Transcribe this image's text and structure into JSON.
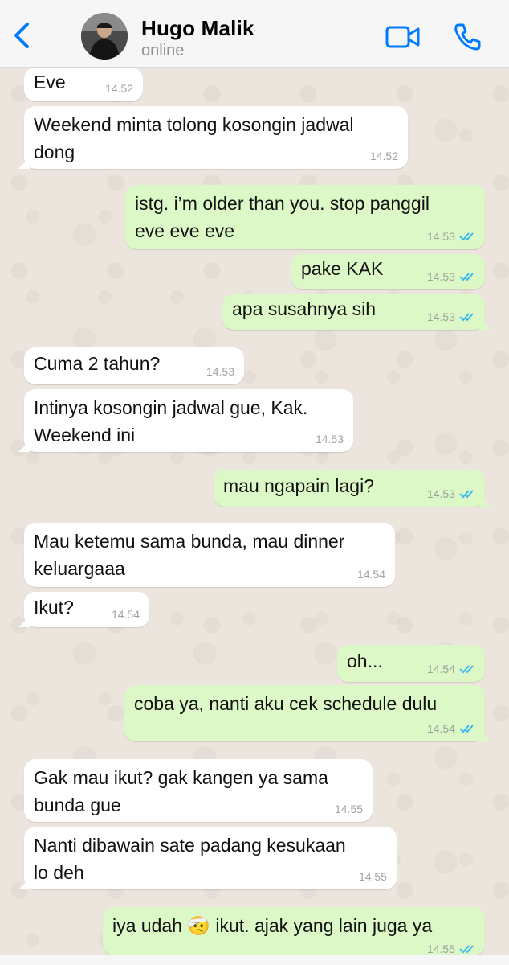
{
  "header": {
    "contact_name": "Hugo Malik",
    "status": "online"
  },
  "icons": {
    "back": "chevron-left-icon",
    "video": "video-call-icon",
    "call": "phone-icon",
    "read_receipt": "double-check-icon"
  },
  "colors": {
    "accent": "#007AFF",
    "incoming_bubble": "#FFFFFF",
    "outgoing_bubble": "#DCF8C6",
    "read_ticks": "#34B7F1"
  },
  "messages": [
    {
      "dir": "in",
      "text": "Eve",
      "time": "14.52"
    },
    {
      "dir": "in",
      "text": "Weekend minta tolong kosongin jadwal\ndong",
      "time": "14.52"
    },
    {
      "dir": "out",
      "text": "istg. i’m older than you. stop panggil\neve eve eve",
      "time": "14.53"
    },
    {
      "dir": "out",
      "text": "pake KAK",
      "time": "14.53"
    },
    {
      "dir": "out",
      "text": "apa susahnya sih",
      "time": "14.53"
    },
    {
      "dir": "in",
      "text": "Cuma 2 tahun?",
      "time": "14.53"
    },
    {
      "dir": "in",
      "text": "Intinya kosongin jadwal gue, Kak.\nWeekend ini",
      "time": "14.53"
    },
    {
      "dir": "out",
      "text": "mau ngapain lagi?",
      "time": "14.53"
    },
    {
      "dir": "in",
      "text": "Mau ketemu sama bunda, mau dinner\nkeluargaaa",
      "time": "14.54"
    },
    {
      "dir": "in",
      "text": "Ikut?",
      "time": "14.54"
    },
    {
      "dir": "out",
      "text": "oh...",
      "time": "14.54"
    },
    {
      "dir": "out",
      "text": "coba ya, nanti aku cek schedule dulu",
      "time": "14.54"
    },
    {
      "dir": "in",
      "text": "Gak mau ikut? gak kangen ya sama\nbunda gue",
      "time": "14.55"
    },
    {
      "dir": "in",
      "text": "Nanti dibawain sate padang kesukaan\nlo deh",
      "time": "14.55"
    },
    {
      "dir": "out",
      "text": "iya udah 🤕 ikut. ajak yang lain juga ya",
      "time": "14.55"
    }
  ]
}
